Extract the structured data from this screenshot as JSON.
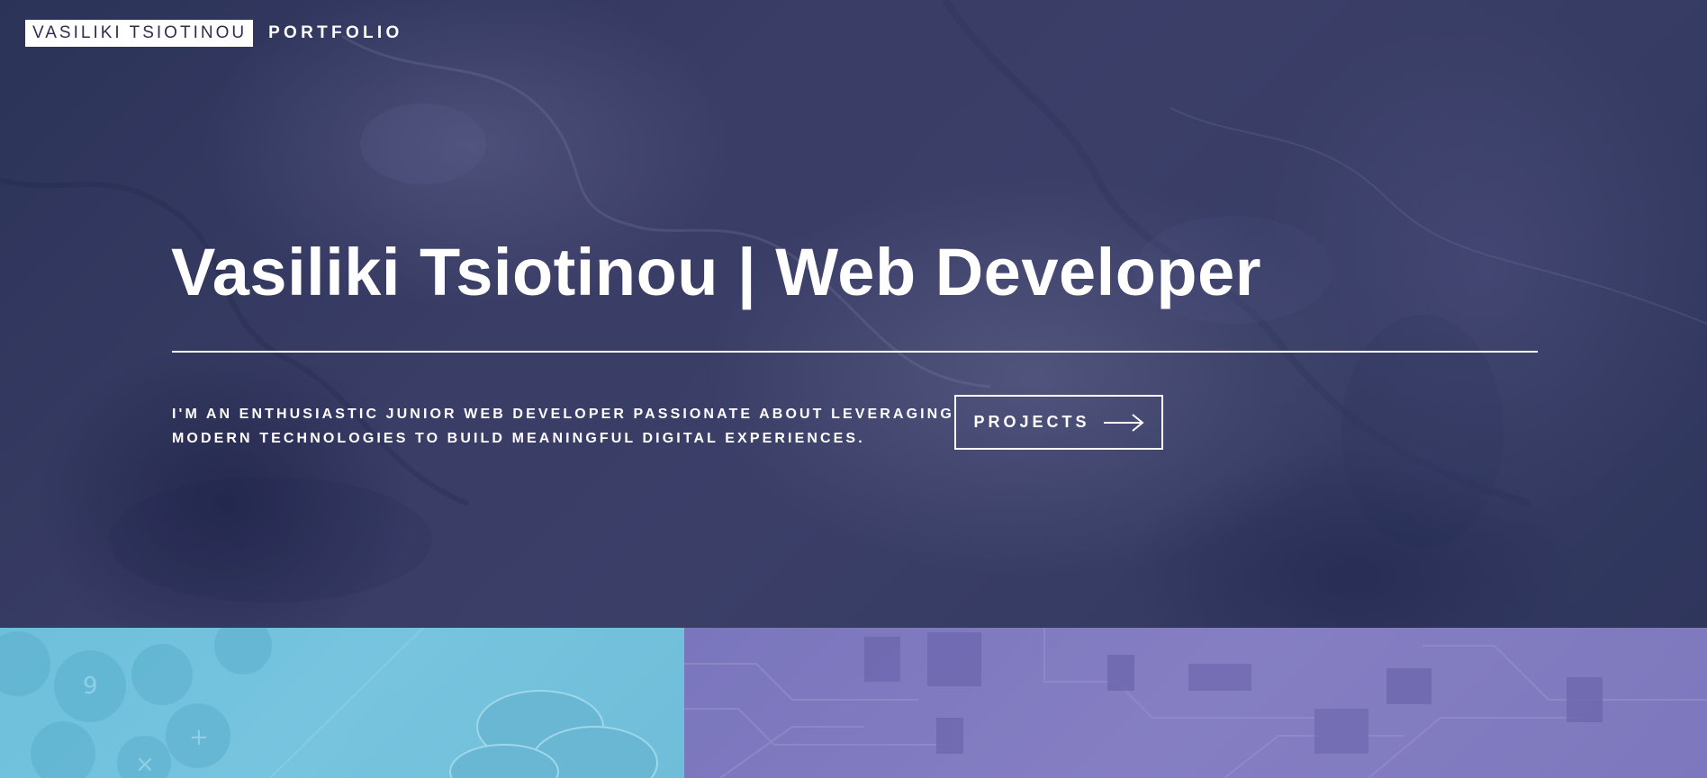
{
  "nav": {
    "brand": "VASILIKI TSIOTINOU",
    "portfolio_link": "PORTFOLIO"
  },
  "hero": {
    "headline": "Vasiliki Tsiotinou | Web Developer",
    "intro": "I'm an enthusiastic junior web developer passionate about leveraging modern technologies to build meaningful digital experiences.",
    "cta_label": "PROJECTS",
    "cta_icon": "arrow-right-icon"
  },
  "colors": {
    "hero_overlay": "#363b63",
    "panel_left": "#74c2dd",
    "panel_right": "#807bc0",
    "brand_text": "#2b2f4d",
    "text": "#ffffff"
  }
}
